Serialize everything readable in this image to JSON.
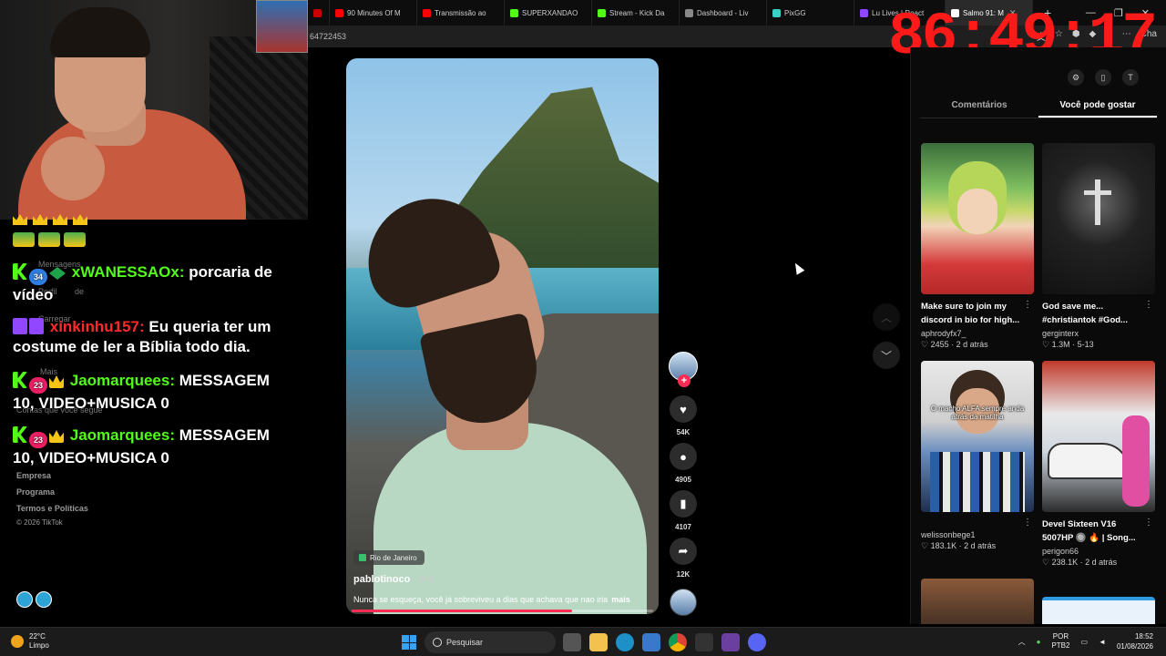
{
  "browser": {
    "tabs": [
      {
        "label": "",
        "color": "#cc0000"
      },
      {
        "label": "90 Minutes Of M",
        "color": "#ff0000"
      },
      {
        "label": "Transmissão ao",
        "color": "#ff0000"
      },
      {
        "label": "SUPERXANDAO",
        "color": "#53fc18"
      },
      {
        "label": "Stream - Kick Da",
        "color": "#53fc18"
      },
      {
        "label": "Dashboard - Liv",
        "color": "#888888"
      },
      {
        "label": "PixGG",
        "color": "#3bd0c7"
      },
      {
        "label": "Lu Lives | React",
        "color": "#9146ff"
      },
      {
        "label": "Salmo 91: M",
        "color": "#ffffff"
      }
    ],
    "address": "64722453",
    "translate_hint": "Cha"
  },
  "timer": "86:49:17",
  "chat": {
    "messages": [
      {
        "user": "xWANESSAOx:",
        "text": "porcaria de vídeo",
        "badge_num": "34",
        "user_color": "#53fc18"
      },
      {
        "user": "xinkinhu157:",
        "text": "Eu queria ter um costume de ler a Bíblia todo dia.",
        "user_color": "#ff2a2a"
      },
      {
        "user": "Jaomarquees:",
        "text": "MESSAGEM 10, VIDEO+MUSICA 0",
        "badge_num": "23",
        "user_color": "#53fc18"
      },
      {
        "user": "Jaomarquees:",
        "text": "MESSAGEM 10, VIDEO+MUSICA 0",
        "badge_num": "23",
        "user_color": "#53fc18"
      }
    ]
  },
  "sidebar_ghost": {
    "items": [
      "Mensagens",
      "Perfil",
      "de",
      "Carregar",
      "Mais",
      "Contas que você segue"
    ],
    "footer": [
      "Empresa",
      "Programa",
      "Termos e Políticas",
      "© 2026 TikTok"
    ]
  },
  "video": {
    "location": "Rio de Janeiro",
    "author": "pablotinoco",
    "date": "· 6-9",
    "caption": "Nunca se esqueça, você já sobreviveu a dias que achava que nao iria",
    "more": "mais",
    "progress": 0.73,
    "likes": "54K",
    "comments": "4905",
    "saves": "4107",
    "shares": "12K"
  },
  "right_panel": {
    "tabs": [
      "Comentários",
      "Você pode gostar"
    ],
    "active_tab": 1,
    "cards": [
      {
        "title": "Make sure to join my discord in bio for high...",
        "author": "aphrodyfx7_",
        "likes": "♡ 2455",
        "date": "2 d atrás"
      },
      {
        "title": "God save me... #christiantok #God...",
        "author": "gerginterx",
        "likes": "♡ 1.3M",
        "date": "5-13"
      },
      {
        "title": "",
        "author": "welissonbege1",
        "likes": "♡ 183.1K",
        "date": "2 d atrás",
        "overlay": "O macho ALFA sempre anda atrás da matilha"
      },
      {
        "title": "Devel Sixteen V16 5007HP 🔘 🔥 | Song...",
        "author": "perigon66",
        "likes": "♡ 238.1K",
        "date": "2 d atrás"
      }
    ]
  },
  "taskbar": {
    "temp": "22°C",
    "weather": "Limpo",
    "search": "Pesquisar",
    "lang1": "POR",
    "lang2": "PTB2",
    "time": "18:52",
    "date": "01/08/2026"
  }
}
